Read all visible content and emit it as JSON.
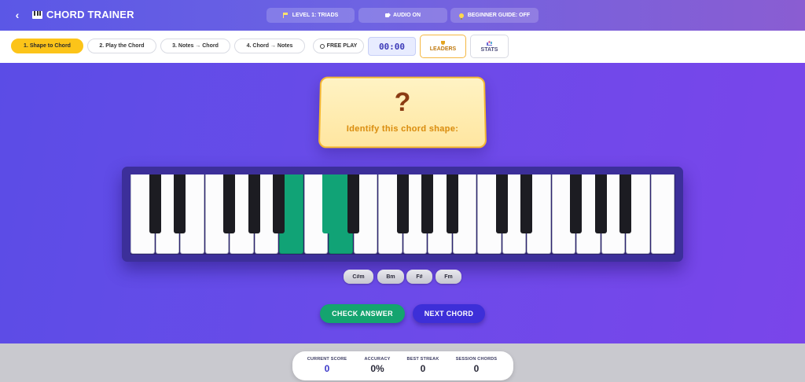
{
  "header": {
    "back_label": "‹",
    "title": "CHORD TRAINER",
    "level": "LEVEL 1: TRIADS",
    "audio": "AUDIO ON",
    "guide": "BEGINNER GUIDE: OFF"
  },
  "toolbar": {
    "tabs": [
      {
        "label": "1. Shape to Chord",
        "active": true
      },
      {
        "label": "2. Play the Chord",
        "active": false
      },
      {
        "label": "3. Notes → Chord",
        "active": false
      },
      {
        "label": "4. Chord → Notes",
        "active": false
      }
    ],
    "free_play": "FREE PLAY",
    "timer": "00:00",
    "leaders": "LEADERS",
    "stats": "STATS"
  },
  "question": {
    "mark": "?",
    "prompt": "Identify this chord shape:"
  },
  "piano": {
    "white_key_count": 22,
    "highlighted_white_keys": [
      6,
      8
    ],
    "highlighted_black_keys": [
      7
    ],
    "highlight_color": "#11a376"
  },
  "choices": [
    "C#m",
    "Bm",
    "F#",
    "Fm"
  ],
  "actions": {
    "check": "CHECK ANSWER",
    "next": "NEXT CHORD"
  },
  "scoreboard": {
    "current_score_label": "CURRENT SCORE",
    "current_score": "0",
    "accuracy_label": "ACCURACY",
    "accuracy": "0%",
    "best_streak_label": "BEST STREAK",
    "best_streak": "0",
    "session_chords_label": "SESSION CHORDS",
    "session_chords": "0"
  },
  "colors": {
    "accent": "#fcc419",
    "header_start": "#5b57e6",
    "stage": "#6a4be9",
    "check_button": "#14a46f",
    "next_button": "#3d2fd8"
  }
}
